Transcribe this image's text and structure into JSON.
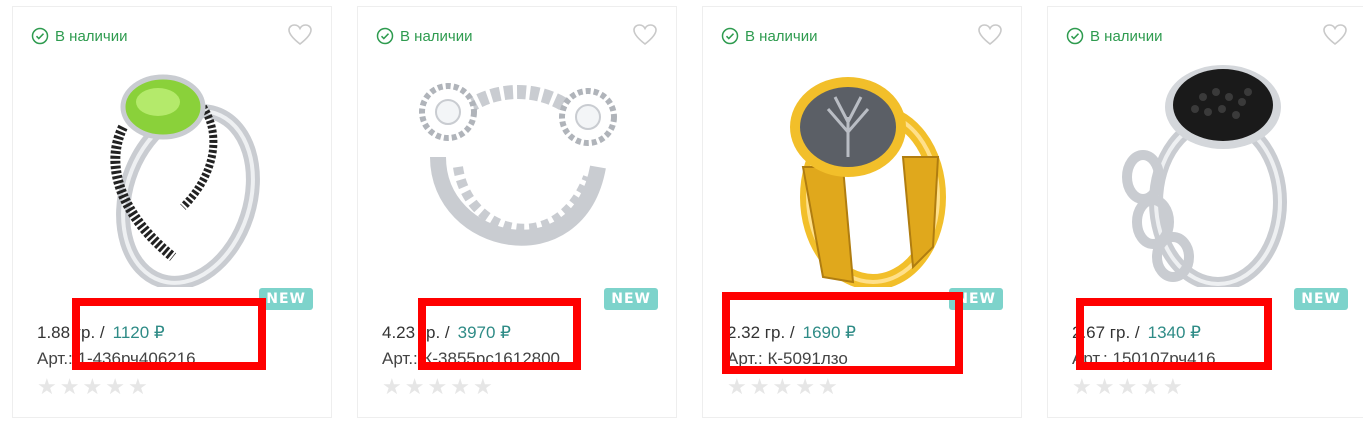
{
  "products": [
    {
      "stock": "В наличии",
      "badge": "NEW",
      "weight": "1.88 гр. /",
      "price": "1120 ₽",
      "article": "Арт.: 1-436рч406216",
      "rating": "0 of 5",
      "stone_color": "#8ad13a",
      "metal_color": "#c9ccd1"
    },
    {
      "stock": "В наличии",
      "badge": "NEW",
      "weight": "4.23 гр. /",
      "price": "3970 ₽",
      "article": "Арт.: К-3855рс1612800",
      "rating": "0 of 5",
      "stone_color": "#ffffff",
      "metal_color": "#c9ccd1"
    },
    {
      "stock": "В наличии",
      "badge": "NEW",
      "weight": "2.32 гр. /",
      "price": "1690 ₽",
      "article": "Арт.: К-5091лзо",
      "rating": "0 of 5",
      "stone_color": "#5b5f66",
      "metal_color": "#f2bf2a"
    },
    {
      "stock": "В наличии",
      "badge": "NEW",
      "weight": "2.67 гр. /",
      "price": "1340 ₽",
      "article": "Арт.: 150107рч416",
      "rating": "0 of 5",
      "stone_color": "#1a1a1a",
      "metal_color": "#c9ccd1"
    }
  ],
  "colors": {
    "in_stock": "#2e9b4f",
    "price": "#2e8b86",
    "badge_bg": "#7dd3cb",
    "highlight": "#ff0000",
    "star_empty": "#e6e6e6"
  },
  "icons": [
    "check-circle-icon",
    "heart-icon",
    "star-icon"
  ]
}
